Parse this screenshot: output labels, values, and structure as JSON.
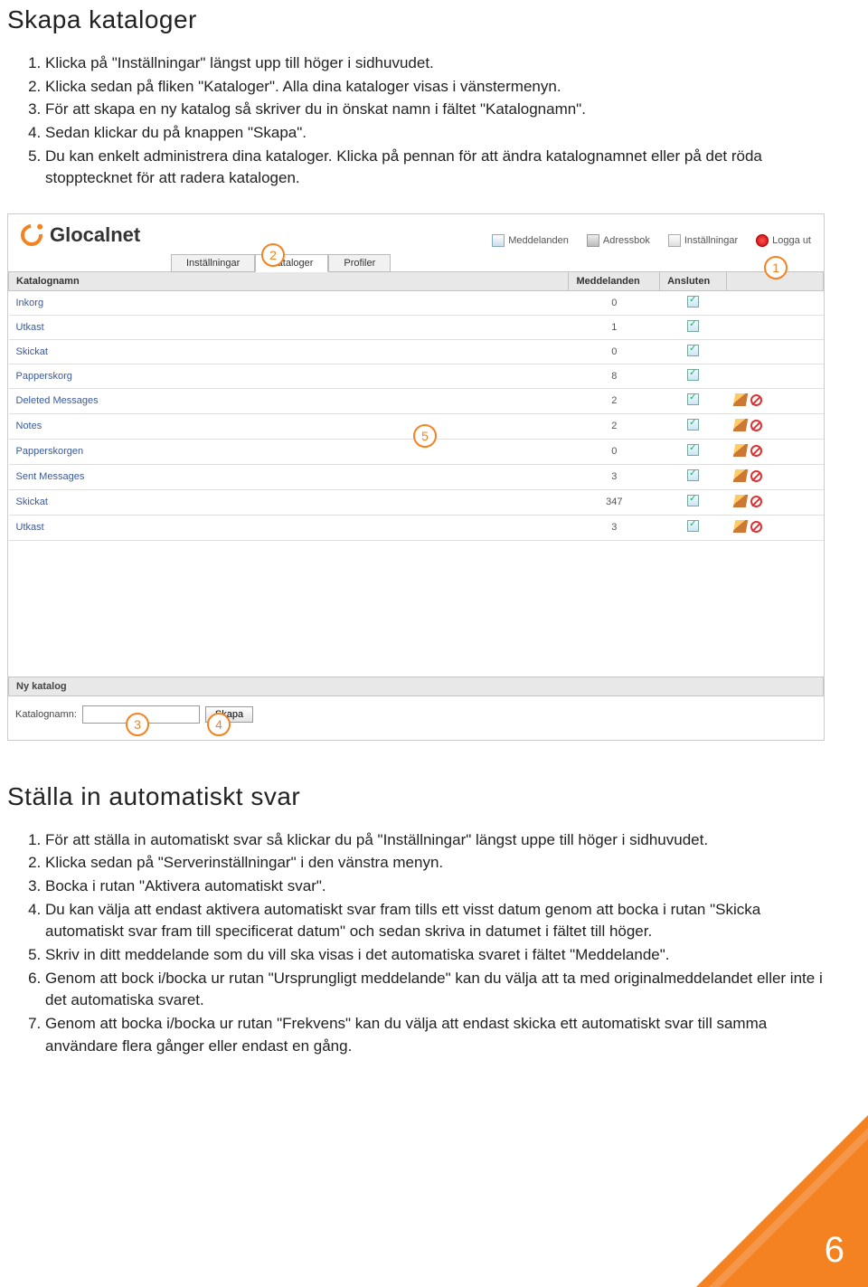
{
  "section1": {
    "title": "Skapa kataloger",
    "steps": [
      "Klicka på \"Inställningar\" längst upp till höger i sidhuvudet.",
      "Klicka sedan på fliken \"Kataloger\". Alla dina kataloger visas i vänstermenyn.",
      "För att skapa en ny katalog så skriver du in önskat namn i fältet \"Katalognamn\".",
      "Sedan klickar du på knappen \"Skapa\".",
      "Du kan enkelt administrera dina kataloger. Klicka på pennan för att ändra katalognamnet eller på det röda stopptecknet för att radera katalogen."
    ]
  },
  "shot": {
    "brand": "Glocalnet",
    "toplinks": {
      "meddelanden": "Meddelanden",
      "adressbok": "Adressbok",
      "installningar": "Inställningar",
      "loggaut": "Logga ut"
    },
    "tabs": {
      "installningar": "Inställningar",
      "kataloger": "Kataloger",
      "profiler": "Profiler"
    },
    "tableHeaders": {
      "name": "Katalognamn",
      "count": "Meddelanden",
      "connected": "Ansluten"
    },
    "rows": [
      {
        "name": "Inkorg",
        "count": "0",
        "checked": true,
        "fixed": true
      },
      {
        "name": "Utkast",
        "count": "1",
        "checked": true,
        "fixed": true
      },
      {
        "name": "Skickat",
        "count": "0",
        "checked": true,
        "fixed": true
      },
      {
        "name": "Papperskorg",
        "count": "8",
        "checked": true,
        "fixed": true
      },
      {
        "name": "Deleted Messages",
        "count": "2",
        "checked": true,
        "fixed": false
      },
      {
        "name": "Notes",
        "count": "2",
        "checked": true,
        "fixed": false
      },
      {
        "name": "Papperskorgen",
        "count": "0",
        "checked": true,
        "fixed": false
      },
      {
        "name": "Sent Messages",
        "count": "3",
        "checked": true,
        "fixed": false
      },
      {
        "name": "Skickat",
        "count": "347",
        "checked": true,
        "fixed": false
      },
      {
        "name": "Utkast",
        "count": "3",
        "checked": true,
        "fixed": false
      }
    ],
    "newCatalog": {
      "barLabel": "Ny katalog",
      "fieldLabel": "Katalognamn:",
      "button": "Skapa"
    },
    "callouts": {
      "c1": "1",
      "c2": "2",
      "c3": "3",
      "c4": "4",
      "c5": "5"
    }
  },
  "section2": {
    "title": "Ställa in automatiskt svar",
    "steps": [
      "För att ställa in automatiskt svar så klickar du på \"Inställningar\" längst uppe till höger i sidhuvudet.",
      "Klicka sedan på \"Serverinställningar\" i den vänstra menyn.",
      "Bocka i rutan \"Aktivera automatiskt svar\".",
      "Du kan välja att endast aktivera automatiskt svar fram tills ett visst datum genom att bocka i rutan \"Skicka automatiskt svar fram till specificerat datum\" och sedan skriva in datumet i fältet till höger.",
      "Skriv in ditt meddelande som du vill ska visas i det automatiska svaret i fältet \"Meddelande\".",
      "Genom att bock i/bocka ur rutan \"Ursprungligt meddelande\" kan du välja att ta med originalmeddelandet eller inte i det automatiska svaret.",
      "Genom att bocka i/bocka ur rutan \"Frekvens\" kan du välja att endast skicka ett automatiskt svar till samma användare flera gånger eller endast en gång."
    ]
  },
  "pageNumber": "6"
}
